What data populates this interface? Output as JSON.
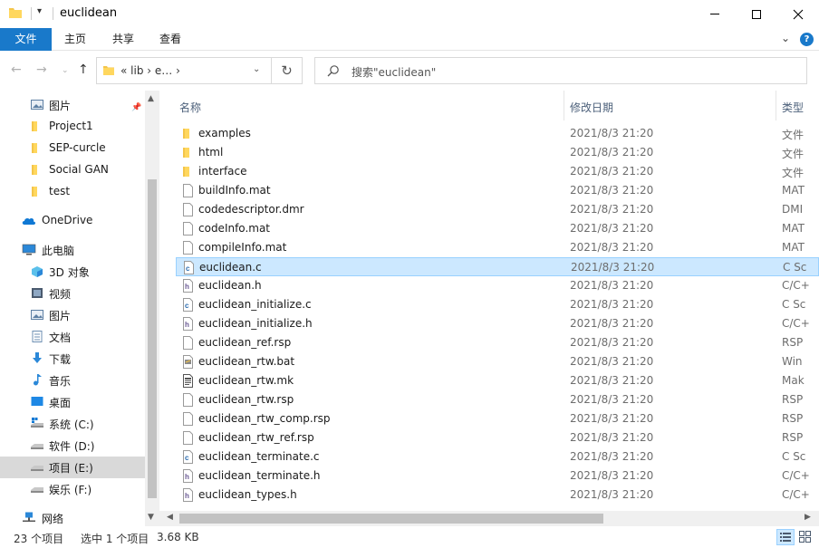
{
  "window": {
    "title": "euclidean",
    "quick_access_down": "▾"
  },
  "ribbon": {
    "tabs": [
      "文件",
      "主页",
      "共享",
      "查看"
    ],
    "expand_icon": "chevron-down-icon",
    "help": "?"
  },
  "address": {
    "crumbs": "« lib › e… ›",
    "search_placeholder": "搜索\"euclidean\""
  },
  "nav": {
    "items": [
      {
        "label": "图片",
        "icon": "pictures-icon",
        "pinned": true
      },
      {
        "label": "Project1",
        "icon": "folder-icon"
      },
      {
        "label": "SEP-curcle",
        "icon": "folder-icon"
      },
      {
        "label": "Social GAN",
        "icon": "folder-icon"
      },
      {
        "label": "test",
        "icon": "folder-icon"
      },
      {
        "label": "OneDrive",
        "icon": "cloud-icon"
      },
      {
        "label": "此电脑",
        "icon": "computer-icon"
      },
      {
        "label": "3D 对象",
        "icon": "cube-icon"
      },
      {
        "label": "视频",
        "icon": "video-icon"
      },
      {
        "label": "图片",
        "icon": "pictures-icon"
      },
      {
        "label": "文档",
        "icon": "document-icon"
      },
      {
        "label": "下载",
        "icon": "download-icon"
      },
      {
        "label": "音乐",
        "icon": "music-icon"
      },
      {
        "label": "桌面",
        "icon": "desktop-icon"
      },
      {
        "label": "系统 (C:)",
        "icon": "system-drive-icon"
      },
      {
        "label": "软件 (D:)",
        "icon": "drive-icon"
      },
      {
        "label": "项目 (E:)",
        "icon": "drive-icon",
        "selected": true
      },
      {
        "label": "娱乐 (F:)",
        "icon": "drive-icon"
      },
      {
        "label": "网络",
        "icon": "network-icon"
      }
    ]
  },
  "columns": {
    "name": "名称",
    "date": "修改日期",
    "type": "类型"
  },
  "files": [
    {
      "name": "examples",
      "date": "2021/8/3 21:20",
      "type": "文件",
      "icon": "folder-icon"
    },
    {
      "name": "html",
      "date": "2021/8/3 21:20",
      "type": "文件",
      "icon": "folder-icon"
    },
    {
      "name": "interface",
      "date": "2021/8/3 21:20",
      "type": "文件",
      "icon": "folder-icon"
    },
    {
      "name": "buildInfo.mat",
      "date": "2021/8/3 21:20",
      "type": "MAT",
      "icon": "file-icon"
    },
    {
      "name": "codedescriptor.dmr",
      "date": "2021/8/3 21:20",
      "type": "DMI",
      "icon": "file-icon"
    },
    {
      "name": "codeInfo.mat",
      "date": "2021/8/3 21:20",
      "type": "MAT",
      "icon": "file-icon"
    },
    {
      "name": "compileInfo.mat",
      "date": "2021/8/3 21:20",
      "type": "MAT",
      "icon": "file-icon"
    },
    {
      "name": "euclidean.c",
      "date": "2021/8/3 21:20",
      "type": "C Sc",
      "icon": "c-file-icon",
      "selected": true
    },
    {
      "name": "euclidean.h",
      "date": "2021/8/3 21:20",
      "type": "C/C+",
      "icon": "h-file-icon"
    },
    {
      "name": "euclidean_initialize.c",
      "date": "2021/8/3 21:20",
      "type": "C Sc",
      "icon": "c-file-icon"
    },
    {
      "name": "euclidean_initialize.h",
      "date": "2021/8/3 21:20",
      "type": "C/C+",
      "icon": "h-file-icon"
    },
    {
      "name": "euclidean_ref.rsp",
      "date": "2021/8/3 21:20",
      "type": "RSP",
      "icon": "file-icon"
    },
    {
      "name": "euclidean_rtw.bat",
      "date": "2021/8/3 21:20",
      "type": "Win",
      "icon": "bat-file-icon"
    },
    {
      "name": "euclidean_rtw.mk",
      "date": "2021/8/3 21:20",
      "type": "Mak",
      "icon": "mk-file-icon"
    },
    {
      "name": "euclidean_rtw.rsp",
      "date": "2021/8/3 21:20",
      "type": "RSP",
      "icon": "file-icon"
    },
    {
      "name": "euclidean_rtw_comp.rsp",
      "date": "2021/8/3 21:20",
      "type": "RSP",
      "icon": "file-icon"
    },
    {
      "name": "euclidean_rtw_ref.rsp",
      "date": "2021/8/3 21:20",
      "type": "RSP",
      "icon": "file-icon"
    },
    {
      "name": "euclidean_terminate.c",
      "date": "2021/8/3 21:20",
      "type": "C Sc",
      "icon": "c-file-icon"
    },
    {
      "name": "euclidean_terminate.h",
      "date": "2021/8/3 21:20",
      "type": "C/C+",
      "icon": "h-file-icon"
    },
    {
      "name": "euclidean_types.h",
      "date": "2021/8/3 21:20",
      "type": "C/C+",
      "icon": "h-file-icon"
    }
  ],
  "status": {
    "count": "23 个项目",
    "selection": "选中 1 个项目",
    "size": "3.68 KB"
  },
  "colors": {
    "accent": "#1979ca",
    "selection_bg": "#cce8ff",
    "selection_border": "#99d1ff",
    "folder": "#f4c54a"
  }
}
